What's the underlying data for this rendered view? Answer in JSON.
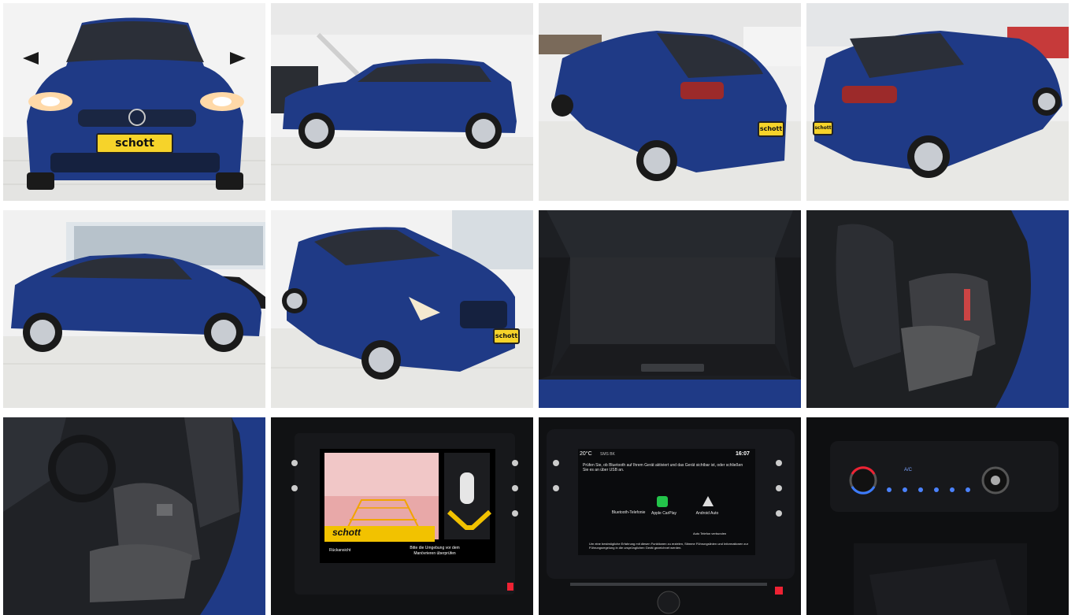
{
  "gallery": {
    "brand_plate": "schott",
    "vehicle_color": "#1f3a86",
    "photos": [
      {
        "subject": "front"
      },
      {
        "subject": "side-right"
      },
      {
        "subject": "rear-left"
      },
      {
        "subject": "rear-right"
      },
      {
        "subject": "side-left"
      },
      {
        "subject": "front-left"
      },
      {
        "subject": "trunk"
      },
      {
        "subject": "rear-seats"
      },
      {
        "subject": "front-seats"
      },
      {
        "subject": "rear-camera-screen",
        "screen": {
          "camera_label": "Rückansicht",
          "hint_text": "Bitte die Umgebung vor dem Manövrieren überprüfen",
          "plate_text": "schott"
        }
      },
      {
        "subject": "infotainment-screen",
        "screen": {
          "temperature": "20°C",
          "network": "SMS BK",
          "time": "16:07",
          "message": "Prüfen Sie, ob Bluetooth auf Ihrem Gerät aktiviert und das Gerät sichtbar ist, oder schließen Sie es an über USB an.",
          "options": [
            "Bluetooth-Telefonie",
            "Apple CarPlay",
            "Android Auto"
          ],
          "auto_label": "Auto Telefon verbunden",
          "info_text": "Um eine bestmögliche Erfahrung mit diesen Funktionen zu erzielen, Stimme Führungslinien und Informationen zur Führungsregelung in die ursprünglichen Gerät gezeichnet werden."
        }
      },
      {
        "subject": "climate-controls",
        "control_label": "A/C"
      }
    ]
  }
}
